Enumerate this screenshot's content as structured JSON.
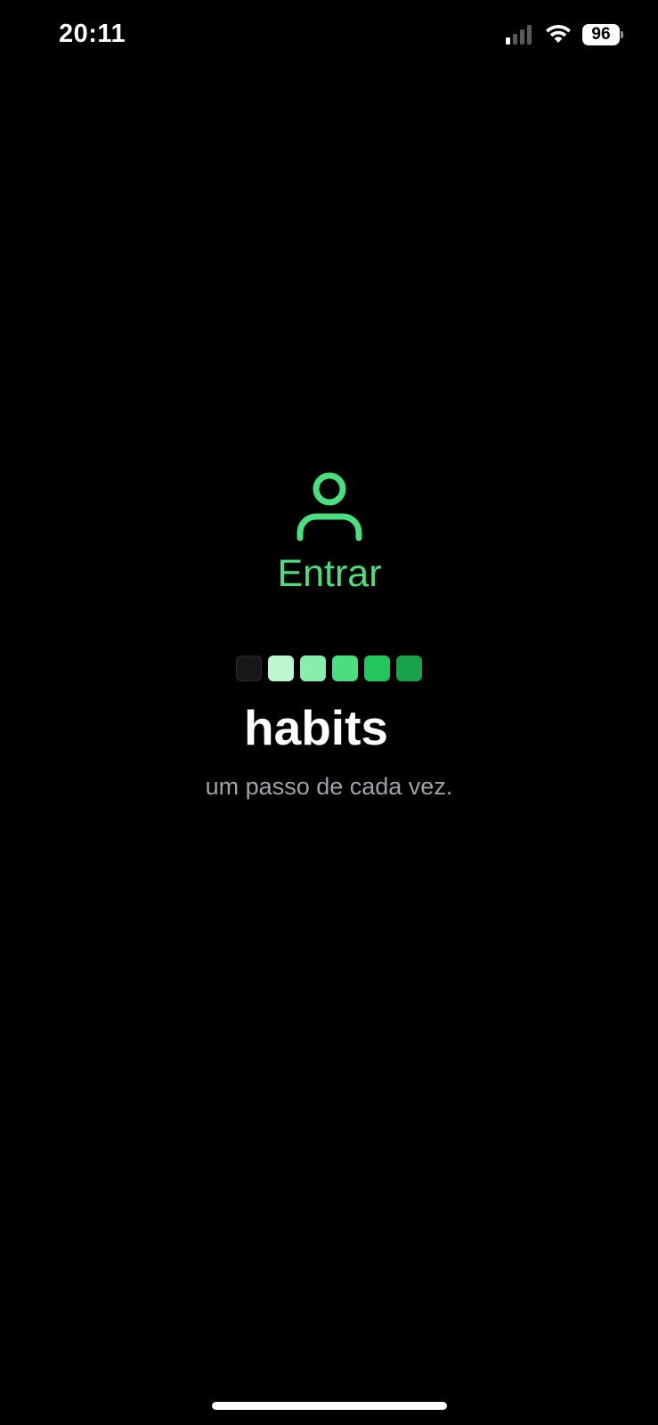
{
  "status_bar": {
    "time": "20:11",
    "battery_level": "96",
    "icons": [
      "signal-icon",
      "wifi-icon",
      "battery-icon"
    ]
  },
  "login": {
    "icon": "user-icon",
    "label": "Entrar",
    "color": "#4ade80"
  },
  "logo": {
    "square_colors": [
      "#18181b",
      "#bbf7d0",
      "#86efac",
      "#4ade80",
      "#22c55e",
      "#16a34a"
    ]
  },
  "app": {
    "name": "habits",
    "tagline": "um passo de cada vez."
  }
}
